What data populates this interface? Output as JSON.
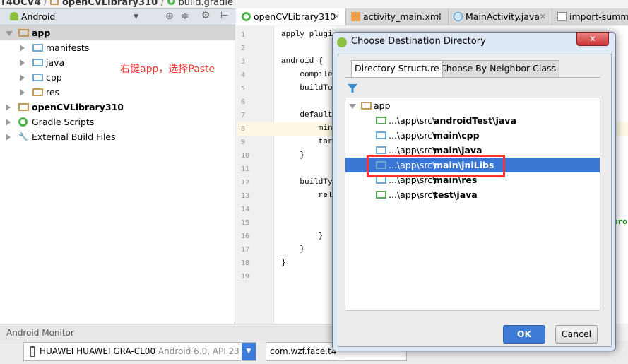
{
  "breadcrumb": [
    "T4OCV4",
    "openCVLibrary310",
    "build.gradle"
  ],
  "project_panel": {
    "view_selector": "Android",
    "tree": [
      {
        "label": "app",
        "bold": true,
        "level": 0,
        "expanded": true,
        "icon": "module-folder-icon"
      },
      {
        "label": "manifests",
        "level": 1,
        "icon": "folder-icon"
      },
      {
        "label": "java",
        "level": 1,
        "icon": "folder-icon"
      },
      {
        "label": "cpp",
        "level": 1,
        "icon": "folder-icon"
      },
      {
        "label": "res",
        "level": 1,
        "icon": "res-folder-icon"
      },
      {
        "label": "openCVLibrary310",
        "bold": true,
        "level": 0,
        "icon": "module-folder-icon"
      },
      {
        "label": "Gradle Scripts",
        "level": 0,
        "icon": "gradle-icon"
      },
      {
        "label": "External Build Files",
        "level": 0,
        "icon": "tools-icon"
      }
    ],
    "annotation": "右键app，选择Paste"
  },
  "editor": {
    "tabs": [
      {
        "label": "openCVLibrary310",
        "active": true
      },
      {
        "label": "activity_main.xml"
      },
      {
        "label": "MainActivity.java"
      },
      {
        "label": "import-summa"
      }
    ],
    "lines": [
      "apply plugi",
      "",
      "android {",
      "    compileS",
      "    buildToo",
      "",
      "    defaultC",
      "        minS",
      "        targ",
      "    }",
      "",
      "    buildTyp",
      "        rele",
      "",
      "",
      "        }",
      "    }",
      "}",
      ""
    ],
    "highlighted_line": 8,
    "overflow_text": "pro"
  },
  "dialog": {
    "title": "Choose Destination Directory",
    "tabs": [
      "Directory Structure",
      "Choose By Neighbor Class"
    ],
    "root": "app",
    "items": [
      {
        "prefix": "...\\app\\src\\",
        "bold": "androidTest\\java",
        "color": "green"
      },
      {
        "prefix": "...\\app\\src\\",
        "bold": "main\\cpp",
        "color": "blue"
      },
      {
        "prefix": "...\\app\\src\\",
        "bold": "main\\java",
        "color": "blue"
      },
      {
        "prefix": "...\\app\\src\\",
        "bold": "main\\jniLibs",
        "color": "blue",
        "selected": true
      },
      {
        "prefix": "...\\app\\src\\",
        "bold": "main\\res",
        "color": "blue"
      },
      {
        "prefix": "...\\app\\src\\",
        "bold": "test\\java",
        "color": "green"
      }
    ],
    "ok": "OK",
    "cancel": "Cancel"
  },
  "monitor": {
    "title": "Android Monitor",
    "device": "HUAWEI HUAWEI GRA-CL00",
    "device_info": "Android 6.0, API 23",
    "process": "com.wzf.face.t4"
  },
  "colors": {
    "selection": "#3a76d4",
    "annotation": "#ff3333",
    "ok_button": "#3c7bd6"
  }
}
